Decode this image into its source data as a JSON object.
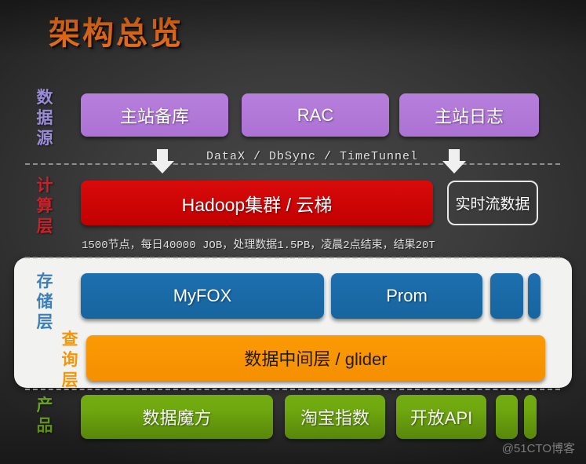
{
  "slide": {
    "title": "架构总览",
    "watermark": "@51CTO博客"
  },
  "layer_labels": {
    "data_source": "数据源",
    "compute": "计算层",
    "storage": "存储层",
    "query": "查询层",
    "product": "产品"
  },
  "rows": {
    "data_source": {
      "boxes": [
        {
          "label": "主站备库",
          "color": "#ac72d4"
        },
        {
          "label": "RAC",
          "color": "#ac72d4"
        },
        {
          "label": "主站日志",
          "color": "#ac72d4"
        }
      ]
    },
    "transport": {
      "label": "DataX / DbSync / TimeTunnel",
      "arrow_icon": "down-arrow"
    },
    "compute": {
      "boxes": [
        {
          "label": "Hadoop集群 / 云梯",
          "color": "#c20000"
        },
        {
          "label": "实时流数据",
          "color": "transparent"
        }
      ],
      "stats": "1500节点，每日40000 JOB，处理数据1.5PB，凌晨2点结束，结果20T"
    },
    "storage": {
      "boxes": [
        {
          "label": "MyFOX",
          "color": "#17659f"
        },
        {
          "label": "Prom",
          "color": "#17659f"
        },
        {
          "label": "",
          "color": "#17659f"
        },
        {
          "label": "",
          "color": "#17659f"
        }
      ]
    },
    "query": {
      "boxes": [
        {
          "label": "数据中间层 / glider",
          "color": "#f59000"
        }
      ]
    },
    "product": {
      "boxes": [
        {
          "label": "数据魔方",
          "color": "#699f0d"
        },
        {
          "label": "淘宝指数",
          "color": "#699f0d"
        },
        {
          "label": "开放API",
          "color": "#699f0d"
        },
        {
          "label": "",
          "color": "#699f0d"
        },
        {
          "label": "",
          "color": "#699f0d"
        }
      ]
    }
  },
  "colors": {
    "title": "#F2711C",
    "purple": "#ac72d4",
    "red": "#c20000",
    "blue": "#17659f",
    "orange": "#f59000",
    "green": "#699f0d",
    "panel": "#f2f2f0",
    "background": "#3c3c3c"
  }
}
